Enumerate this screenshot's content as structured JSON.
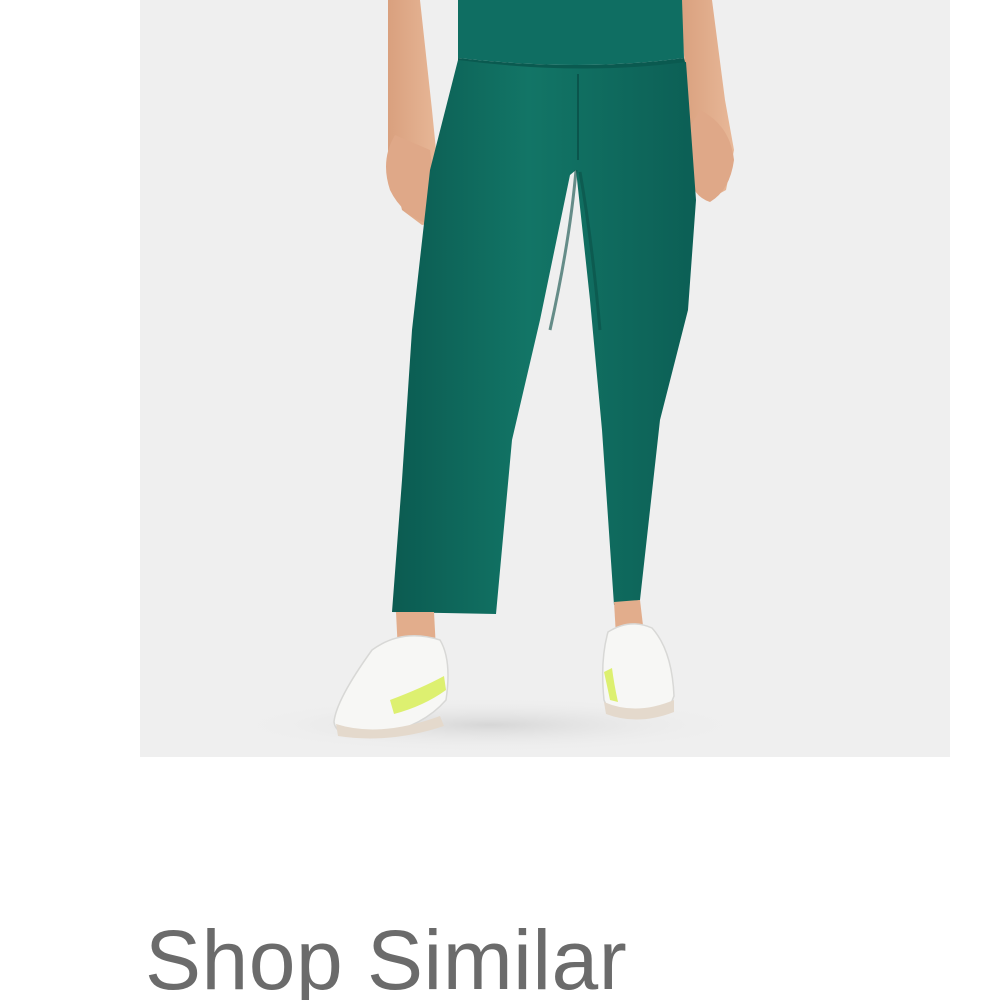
{
  "product": {
    "image_alt": "",
    "legging_color": "#0f6e62",
    "background_color": "#efefef"
  },
  "section": {
    "heading": "Shop Similar"
  }
}
